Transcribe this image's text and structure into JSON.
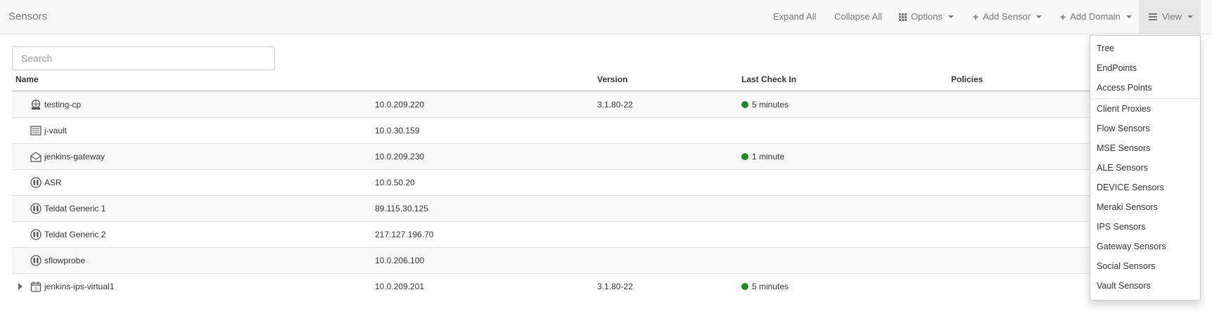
{
  "navbar": {
    "brand": "Sensors",
    "expand_all": "Expand All",
    "collapse_all": "Collapse All",
    "options": "Options",
    "add_sensor": "Add Sensor",
    "add_domain": "Add Domain",
    "view": "View"
  },
  "search": {
    "placeholder": "Search",
    "value": ""
  },
  "table": {
    "headers": {
      "name": "Name",
      "version": "Version",
      "last_check_in": "Last Check In",
      "policies": "Policies"
    },
    "rows": [
      {
        "name": "testing-cp",
        "ip": "10.0.209.220",
        "version": "3.1.80-22",
        "last_check_in": "5 minutes",
        "icon": "proxy-icon",
        "status_color": "#1f8b24"
      },
      {
        "name": "j-vault",
        "ip": "10.0.30.159",
        "version": "",
        "last_check_in": "",
        "icon": "vault-icon"
      },
      {
        "name": "jenkins-gateway",
        "ip": "10.0.209.230",
        "version": "",
        "last_check_in": "1 minute",
        "icon": "gateway-icon",
        "status_color": "#1f8b24"
      },
      {
        "name": "ASR",
        "ip": "10.0.50.20",
        "version": "",
        "last_check_in": "",
        "icon": "flow-sensor-icon"
      },
      {
        "name": "Teldat Generic 1",
        "ip": "89.115.30.125",
        "version": "",
        "last_check_in": "",
        "icon": "flow-sensor-icon"
      },
      {
        "name": "Teldat Generic 2",
        "ip": "217.127.196.70",
        "version": "",
        "last_check_in": "",
        "icon": "flow-sensor-icon"
      },
      {
        "name": "sflowprobe",
        "ip": "10.0.206.100",
        "version": "",
        "last_check_in": "",
        "icon": "flow-sensor-icon"
      },
      {
        "name": "jenkins-ips-virtual1",
        "ip": "10.0.209.201",
        "version": "3.1.80-22",
        "last_check_in": "5 minutes",
        "icon": "ips-icon",
        "status_color": "#1f8b24"
      }
    ]
  },
  "view_menu": {
    "items": [
      "Tree",
      "EndPoints",
      "Access Points",
      "Client Proxies",
      "Flow Sensors",
      "MSE Sensors",
      "ALE Sensors",
      "DEVICE Sensors",
      "Meraki Sensors",
      "IPS Sensors",
      "Gateway Sensors",
      "Social Sensors",
      "Vault Sensors"
    ]
  }
}
